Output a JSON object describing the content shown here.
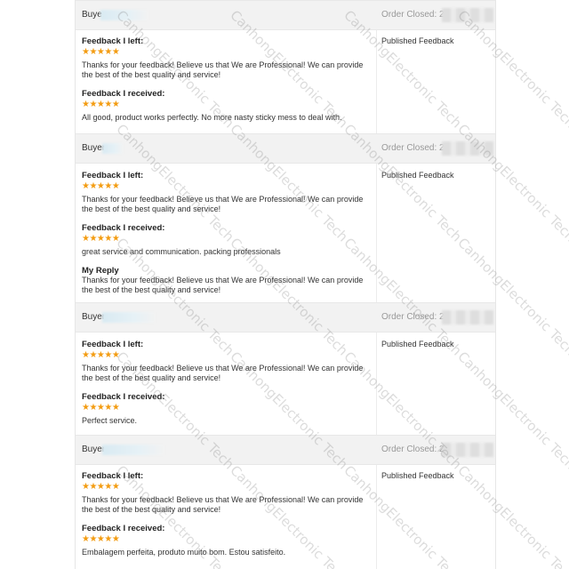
{
  "watermark": "CanhongElectronic Tech",
  "orders": [
    {
      "buyer_label": "Buye",
      "closed_label": "Order Closed: 202",
      "status": "Published Feedback",
      "feedback_left_heading": "Feedback I left:",
      "feedback_left_stars": "★★★★★",
      "feedback_left_text": "Thanks for your feedback! Believe us that We are Professional! We can provide the best of the best quality and service!",
      "feedback_received_heading": "Feedback I received:",
      "feedback_received_stars": "★★★★★",
      "feedback_received_text": "All good, product works perfectly. No more nasty sticky mess to deal with."
    },
    {
      "buyer_label": "Buyer",
      "closed_label": "Order Closed: 20",
      "status": "Published Feedback",
      "feedback_left_heading": "Feedback I left:",
      "feedback_left_stars": "★★★★★",
      "feedback_left_text": "Thanks for your feedback! Believe us that We are Professional! We can provide the best of the best quality and service!",
      "feedback_received_heading": "Feedback I received:",
      "feedback_received_stars": "★★★★★",
      "feedback_received_text": "great service and communication. packing professionals",
      "reply_heading": "My Reply",
      "reply_text": "Thanks for your feedback! Believe us that We are Professional! We can provide the best of the best quality and service!"
    },
    {
      "buyer_label": "Buyer",
      "closed_label": "Order Closed: 20",
      "status": "Published Feedback",
      "feedback_left_heading": "Feedback I left:",
      "feedback_left_stars": "★★★★★",
      "feedback_left_text": "Thanks for your feedback! Believe us that We are Professional! We can provide the best of the best quality and service!",
      "feedback_received_heading": "Feedback I received:",
      "feedback_received_stars": "★★★★★",
      "feedback_received_text": "Perfect service."
    },
    {
      "buyer_label": "Buyer",
      "closed_label": "Order Closed: 20",
      "status": "Published Feedback",
      "feedback_left_heading": "Feedback I left:",
      "feedback_left_stars": "★★★★★",
      "feedback_left_text": "Thanks for your feedback! Believe us that We are Professional! We can provide the best of the best quality and service!",
      "feedback_received_heading": "Feedback I received:",
      "feedback_received_stars": "★★★★★",
      "feedback_received_text": "Embalagem perfeita, produto muito bom. Estou satisfeito."
    }
  ],
  "colors": {
    "star": "#f39c12",
    "header_bg": "#f2f2f2",
    "muted_text": "#999999"
  }
}
